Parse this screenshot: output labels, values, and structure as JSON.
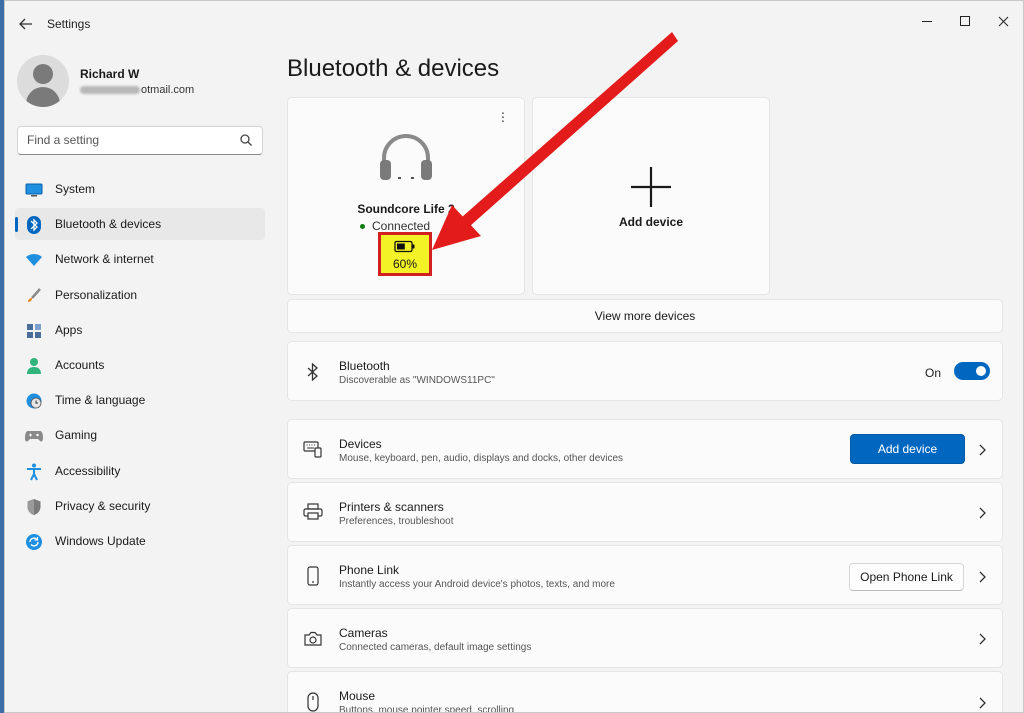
{
  "window": {
    "app_title": "Settings",
    "back_icon": "arrow-left-icon"
  },
  "profile": {
    "name": "Richard W",
    "email_visible": "otmail.com"
  },
  "search": {
    "placeholder": "Find a setting"
  },
  "sidebar": {
    "items": [
      {
        "label": "System",
        "icon": "monitor-icon"
      },
      {
        "label": "Bluetooth & devices",
        "icon": "bluetooth-icon",
        "active": true
      },
      {
        "label": "Network & internet",
        "icon": "wifi-icon"
      },
      {
        "label": "Personalization",
        "icon": "brush-icon"
      },
      {
        "label": "Apps",
        "icon": "apps-icon"
      },
      {
        "label": "Accounts",
        "icon": "person-icon"
      },
      {
        "label": "Time & language",
        "icon": "globe-clock-icon"
      },
      {
        "label": "Gaming",
        "icon": "gamepad-icon"
      },
      {
        "label": "Accessibility",
        "icon": "accessibility-icon"
      },
      {
        "label": "Privacy & security",
        "icon": "shield-icon"
      },
      {
        "label": "Windows Update",
        "icon": "update-icon"
      }
    ]
  },
  "main": {
    "title": "Bluetooth & devices",
    "device_card": {
      "name": "Soundcore Life 2",
      "status": "Connected",
      "battery": "60%",
      "battery_level": 0.6
    },
    "add_card": {
      "label": "Add device"
    },
    "view_more": "View more devices",
    "bluetooth": {
      "title": "Bluetooth",
      "subtitle": "Discoverable as \"WINDOWS11PC\"",
      "toggle_label": "On",
      "toggle_on": true
    },
    "rows": [
      {
        "title": "Devices",
        "subtitle": "Mouse, keyboard, pen, audio, displays and docks, other devices",
        "button": "Add device"
      },
      {
        "title": "Printers & scanners",
        "subtitle": "Preferences, troubleshoot"
      },
      {
        "title": "Phone Link",
        "subtitle": "Instantly access your Android device's photos, texts, and more",
        "button": "Open Phone Link"
      },
      {
        "title": "Cameras",
        "subtitle": "Connected cameras, default image settings"
      },
      {
        "title": "Mouse",
        "subtitle": "Buttons, mouse pointer speed, scrolling"
      }
    ]
  },
  "colors": {
    "accent": "#0067c0",
    "annotation_arrow": "#e31b1b",
    "highlight_fill": "#f2f226",
    "highlight_border": "#d21f1f"
  }
}
